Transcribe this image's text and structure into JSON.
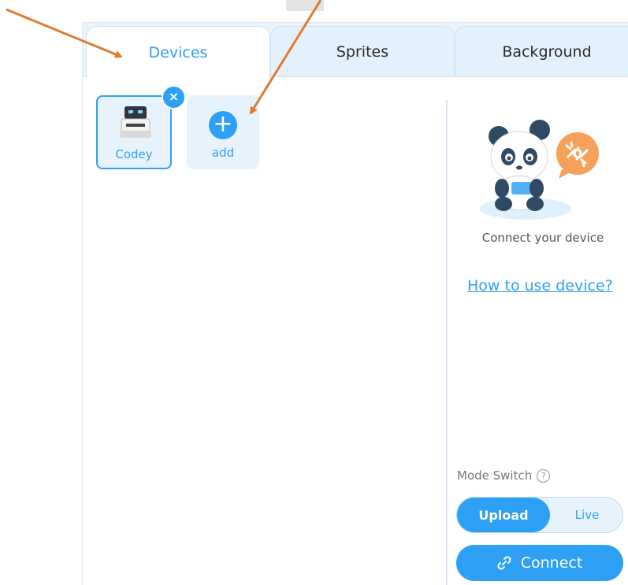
{
  "tabs": [
    {
      "label": "Devices",
      "active": true
    },
    {
      "label": "Sprites",
      "active": false
    },
    {
      "label": "Background",
      "active": false
    }
  ],
  "devices": [
    {
      "label": "Codey",
      "selected": true
    }
  ],
  "remove_icon": "×",
  "add": {
    "label": "add",
    "icon": "+"
  },
  "right_panel": {
    "connect_text": "Connect your device",
    "help_link": "How to use device?",
    "mode_label": "Mode Switch",
    "mode_help_icon": "?",
    "modes": {
      "upload": "Upload",
      "live": "Live",
      "selected": "upload"
    },
    "connect_button": "Connect"
  },
  "colors": {
    "accent": "#2d9ff5",
    "tab_bar": "#e9f4fd",
    "annotation_arrow": "#e07a2e"
  },
  "icons": [
    "close-icon",
    "plus-icon",
    "robot-icon",
    "panda-illustration",
    "broken-link-icon",
    "help-circle-icon",
    "link-icon",
    "annotation-arrow"
  ]
}
